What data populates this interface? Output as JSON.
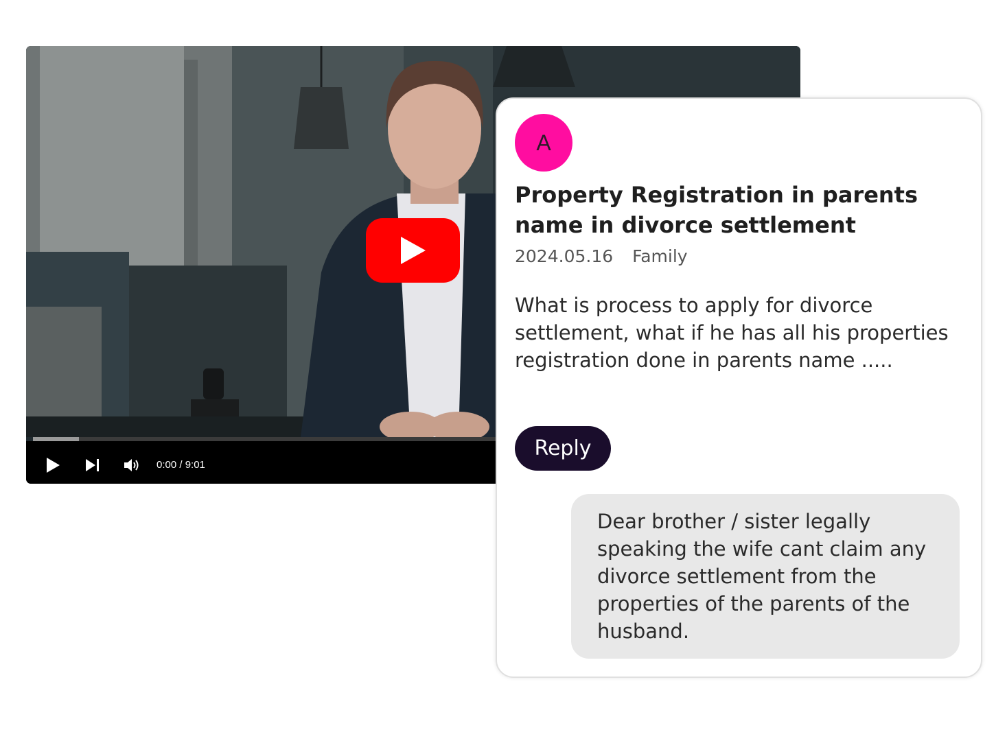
{
  "video": {
    "time_display": "0:00 / 9:01",
    "progress_fraction": 0.06,
    "play_badge_color": "#ff0000",
    "icons": {
      "big_play": "youtube-play-icon",
      "play": "play-icon",
      "next": "skip-next-icon",
      "volume": "volume-icon"
    }
  },
  "question": {
    "avatar_letter": "A",
    "avatar_color": "#ff0da0",
    "title": "Property Registration in parents name in divorce settlement",
    "date": "2024.05.16",
    "category": "Family",
    "body": "What is process to apply for divorce settlement, what if he has all his properties registration done in parents name .....",
    "reply_label": "Reply"
  },
  "answer": {
    "text": "Dear brother / sister legally speaking the wife cant claim any divorce settlement from the properties of the parents of the husband."
  }
}
